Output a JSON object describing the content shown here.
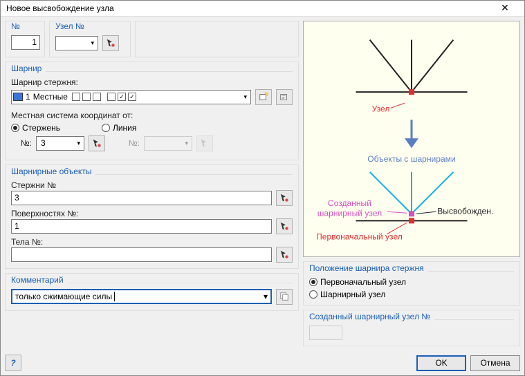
{
  "window": {
    "title": "Новое высвобождение узла"
  },
  "top": {
    "no_label": "№",
    "no_value": "1",
    "node_no_label": "Узел №",
    "node_no_value": ""
  },
  "hinge": {
    "title": "Шарнир",
    "member_hinge_label": "Шарнир стержня:",
    "item_no": "1",
    "item_text": "Местные",
    "local_cs_label": "Местная система координат от:",
    "radio_member": "Стержень",
    "radio_line": "Линия",
    "no_label": "№:",
    "member_no_value": "3",
    "line_no_value": ""
  },
  "objects": {
    "title": "Шарнирные объекты",
    "members_label": "Стержни №",
    "members_value": "3",
    "surfaces_label": "Поверхностях №:",
    "surfaces_value": "1",
    "solids_label": "Тела №:",
    "solids_value": ""
  },
  "comment": {
    "title": "Комментарий",
    "value": "только сжимающие силы"
  },
  "diagram": {
    "node": "Узел",
    "objects_with_hinges": "Объекты с шарнирами",
    "created_hinge_node_l1": "Созданный",
    "created_hinge_node_l2": "шарнирный узел",
    "released": "Высвобожден.",
    "original_node": "Первоначальный узел"
  },
  "position": {
    "title": "Положение шарнира стержня",
    "original": "Первоначальный узел",
    "hinge": "Шарнирный узел"
  },
  "created": {
    "title": "Созданный шарнирный узел №",
    "value": ""
  },
  "buttons": {
    "ok": "OK",
    "cancel": "Отмена"
  }
}
